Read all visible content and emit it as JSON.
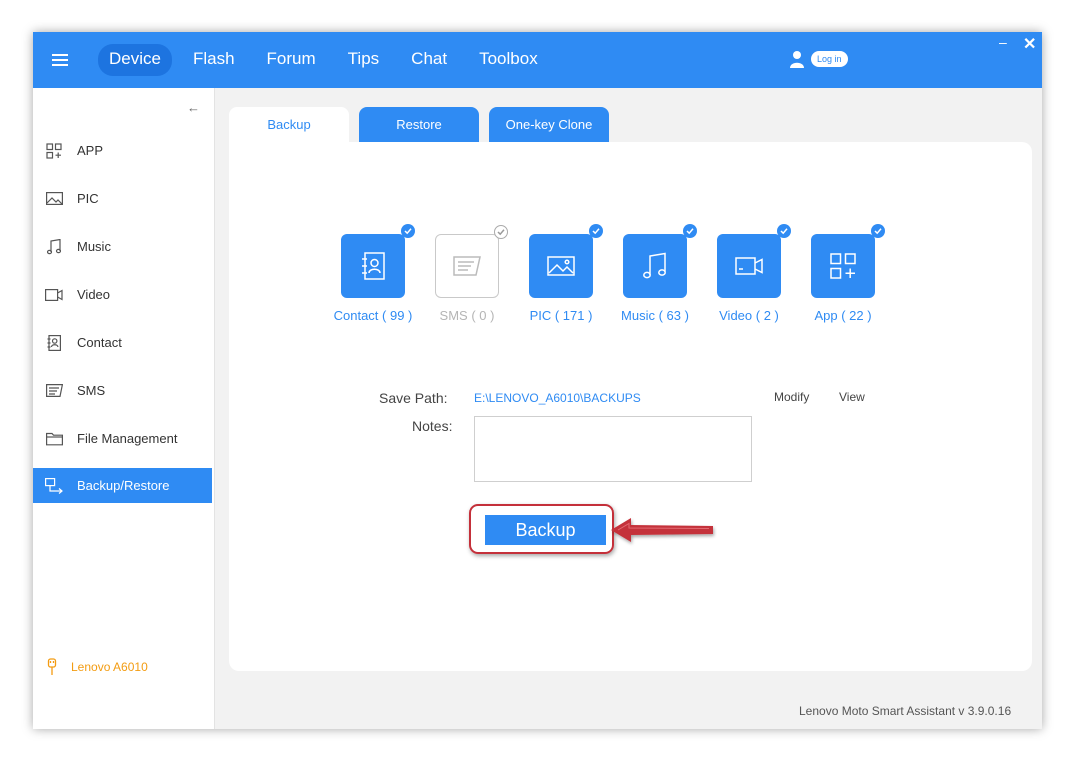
{
  "header": {
    "nav": [
      {
        "label": "Device",
        "active": true
      },
      {
        "label": "Flash",
        "active": false
      },
      {
        "label": "Forum",
        "active": false
      },
      {
        "label": "Tips",
        "active": false
      },
      {
        "label": "Chat",
        "active": false
      },
      {
        "label": "Toolbox",
        "active": false
      }
    ],
    "login_label": "Log in",
    "minimize_symbol": "–",
    "close_symbol": "✕",
    "menu_icon": "hamburger-icon",
    "user_icon": "user-icon"
  },
  "sidebar": {
    "collapse_symbol": "←",
    "items": [
      {
        "label": "APP",
        "icon": "apps-icon",
        "active": false
      },
      {
        "label": "PIC",
        "icon": "image-icon",
        "active": false
      },
      {
        "label": "Music",
        "icon": "music-note-icon",
        "active": false
      },
      {
        "label": "Video",
        "icon": "video-camera-icon",
        "active": false
      },
      {
        "label": "Contact",
        "icon": "contact-book-icon",
        "active": false
      },
      {
        "label": "SMS",
        "icon": "message-icon",
        "active": false
      },
      {
        "label": "File Management",
        "icon": "folder-icon",
        "active": false
      },
      {
        "label": "Backup/Restore",
        "icon": "backup-restore-icon",
        "active": true
      }
    ],
    "device_name": "Lenovo A6010",
    "device_icon": "usb-plug-icon"
  },
  "content": {
    "tabs": [
      {
        "label": "Backup",
        "active": true
      },
      {
        "label": "Restore",
        "active": false
      },
      {
        "label": "One-key Clone",
        "active": false
      }
    ],
    "categories": [
      {
        "label": "Contact ( 99 )",
        "icon": "contact-book-icon",
        "checked": true,
        "enabled": true
      },
      {
        "label": "SMS ( 0 )",
        "icon": "message-icon",
        "checked": true,
        "enabled": false
      },
      {
        "label": "PIC ( 171 )",
        "icon": "image-icon",
        "checked": true,
        "enabled": true
      },
      {
        "label": "Music ( 63 )",
        "icon": "music-note-icon",
        "checked": true,
        "enabled": true
      },
      {
        "label": "Video ( 2 )",
        "icon": "video-camera-icon",
        "checked": true,
        "enabled": true
      },
      {
        "label": "App ( 22 )",
        "icon": "apps-icon",
        "checked": true,
        "enabled": true
      }
    ],
    "save_path_label": "Save Path:",
    "save_path_value": "E:\\LENOVO_A6010\\BACKUPS",
    "modify_label": "Modify",
    "view_label": "View",
    "notes_label": "Notes:",
    "notes_value": "",
    "backup_button_label": "Backup"
  },
  "footer": {
    "version_text": "Lenovo Moto Smart Assistant v 3.9.0.16"
  },
  "colors": {
    "accent": "#2f8bf3",
    "accent_dark": "#1d74e0",
    "device_name": "#f39c12",
    "annotation_red": "#c4303a"
  }
}
